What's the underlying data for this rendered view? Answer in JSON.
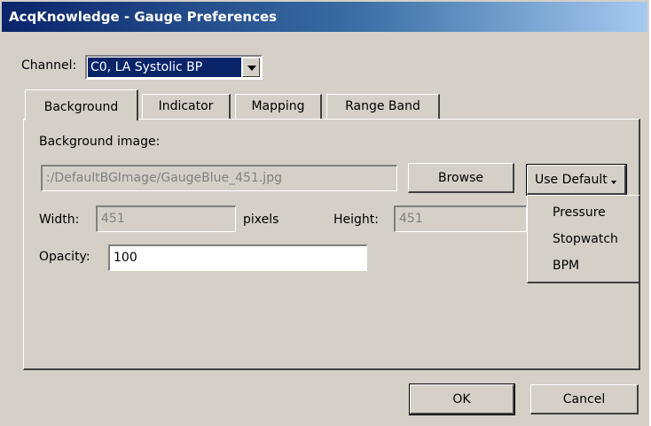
{
  "window": {
    "title": "AcqKnowledge - Gauge Preferences"
  },
  "channel": {
    "label": "Channel:",
    "value": "C0, LA Systolic BP"
  },
  "tabs": [
    {
      "label": "Background",
      "active": true
    },
    {
      "label": "Indicator"
    },
    {
      "label": "Mapping"
    },
    {
      "label": "Range Band"
    }
  ],
  "background": {
    "image_label": "Background image:",
    "image_path": ":/DefaultBGImage/GaugeBlue_451.jpg",
    "browse_label": "Browse",
    "use_default_label": "Use Default",
    "width_label": "Width:",
    "width_value": "451",
    "pixels_label": "pixels",
    "height_label": "Height:",
    "height_value": "451",
    "opacity_label": "Opacity:",
    "opacity_value": "100"
  },
  "menu": {
    "items": [
      "Pressure",
      "Stopwatch",
      "BPM"
    ]
  },
  "footer": {
    "ok_label": "OK",
    "cancel_label": "Cancel"
  },
  "colors": {
    "title_gradient_start": "#0a246a",
    "title_gradient_end": "#a6caf0",
    "face": "#d4d0c8",
    "selection": "#0a246a"
  }
}
